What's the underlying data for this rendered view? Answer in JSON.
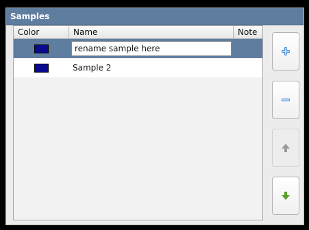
{
  "panel": {
    "title": "Samples"
  },
  "table": {
    "headers": {
      "color": "Color",
      "name": "Name",
      "note": "Note"
    },
    "rows": [
      {
        "color": "#0a0a8f",
        "name": "rename sample here",
        "note": "",
        "selected": true,
        "editing": true
      },
      {
        "color": "#0a0a8f",
        "name": "Sample 2",
        "note": "",
        "selected": false,
        "editing": false
      }
    ]
  },
  "buttons": {
    "add": {
      "icon": "plus-icon",
      "enabled": true
    },
    "remove": {
      "icon": "minus-icon",
      "enabled": true
    },
    "move_up": {
      "icon": "arrow-up-icon",
      "enabled": false
    },
    "move_down": {
      "icon": "arrow-down-icon",
      "enabled": true
    }
  },
  "colors": {
    "header_bg": "#5f7e9f",
    "selection": "#5f7e9f",
    "plus_icon": "#4a90d9",
    "minus_icon": "#4a90d9",
    "up_icon_disabled": "#9a9a9a",
    "down_icon": "#5aa02c"
  }
}
